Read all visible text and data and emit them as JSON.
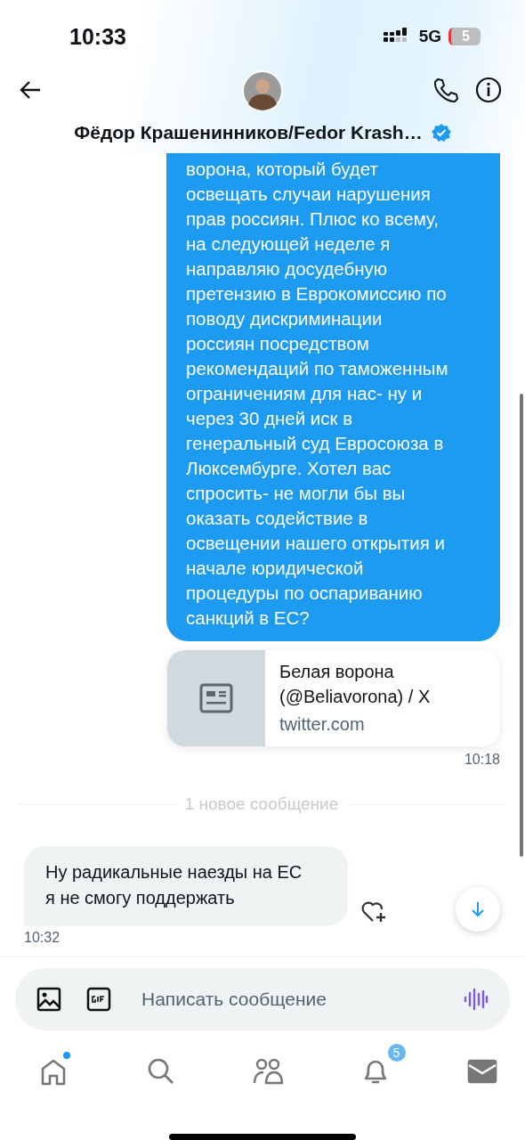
{
  "status_bar": {
    "time": "10:33",
    "network": "5G",
    "battery": "5"
  },
  "header": {
    "name": "Фёдор Крашенинников/Fedor Krash…",
    "verified": true
  },
  "messages": [
    {
      "kind": "sent",
      "text": "ворона, который будет\nосвещать случаи нарушения\nправ россиян. Плюс ко всему,\nна следующей неделе я\nнаправляю досудебную\nпретензию в Еврокомиссию по\nповоду дискриминации\nроссиян посредством\nрекомендаций по таможенным\nограничениям для нас- ну и\nчерез 30 дней иск в\nгенеральный суд Евросоюза в\nЛюксембурге. Хотел вас\nспросить- не могли бы вы\nоказать содействие в\nосвещении нашего открытия и\nначале юридической\nпроцедуры по оспариванию\nсанкций в ЕС?"
    },
    {
      "kind": "link",
      "title": "Белая ворона\n(@Beliavorona) / X",
      "domain": "twitter.com",
      "time": "10:18"
    },
    {
      "kind": "divider",
      "text": "1 новое сообщение"
    },
    {
      "kind": "received",
      "text": "Ну радикальные наезды на ЕС\nя не смогу поддержать",
      "time": "10:32"
    }
  ],
  "composer": {
    "placeholder": "Написать сообщение"
  },
  "nav": [
    {
      "kind": "home",
      "selected": false,
      "dot": true
    },
    {
      "kind": "search",
      "selected": false,
      "dot": false
    },
    {
      "kind": "communities",
      "selected": false,
      "dot": false
    },
    {
      "kind": "notifications",
      "selected": false,
      "dot": false,
      "badge": "5"
    },
    {
      "kind": "messages",
      "selected": true,
      "dot": false
    }
  ]
}
